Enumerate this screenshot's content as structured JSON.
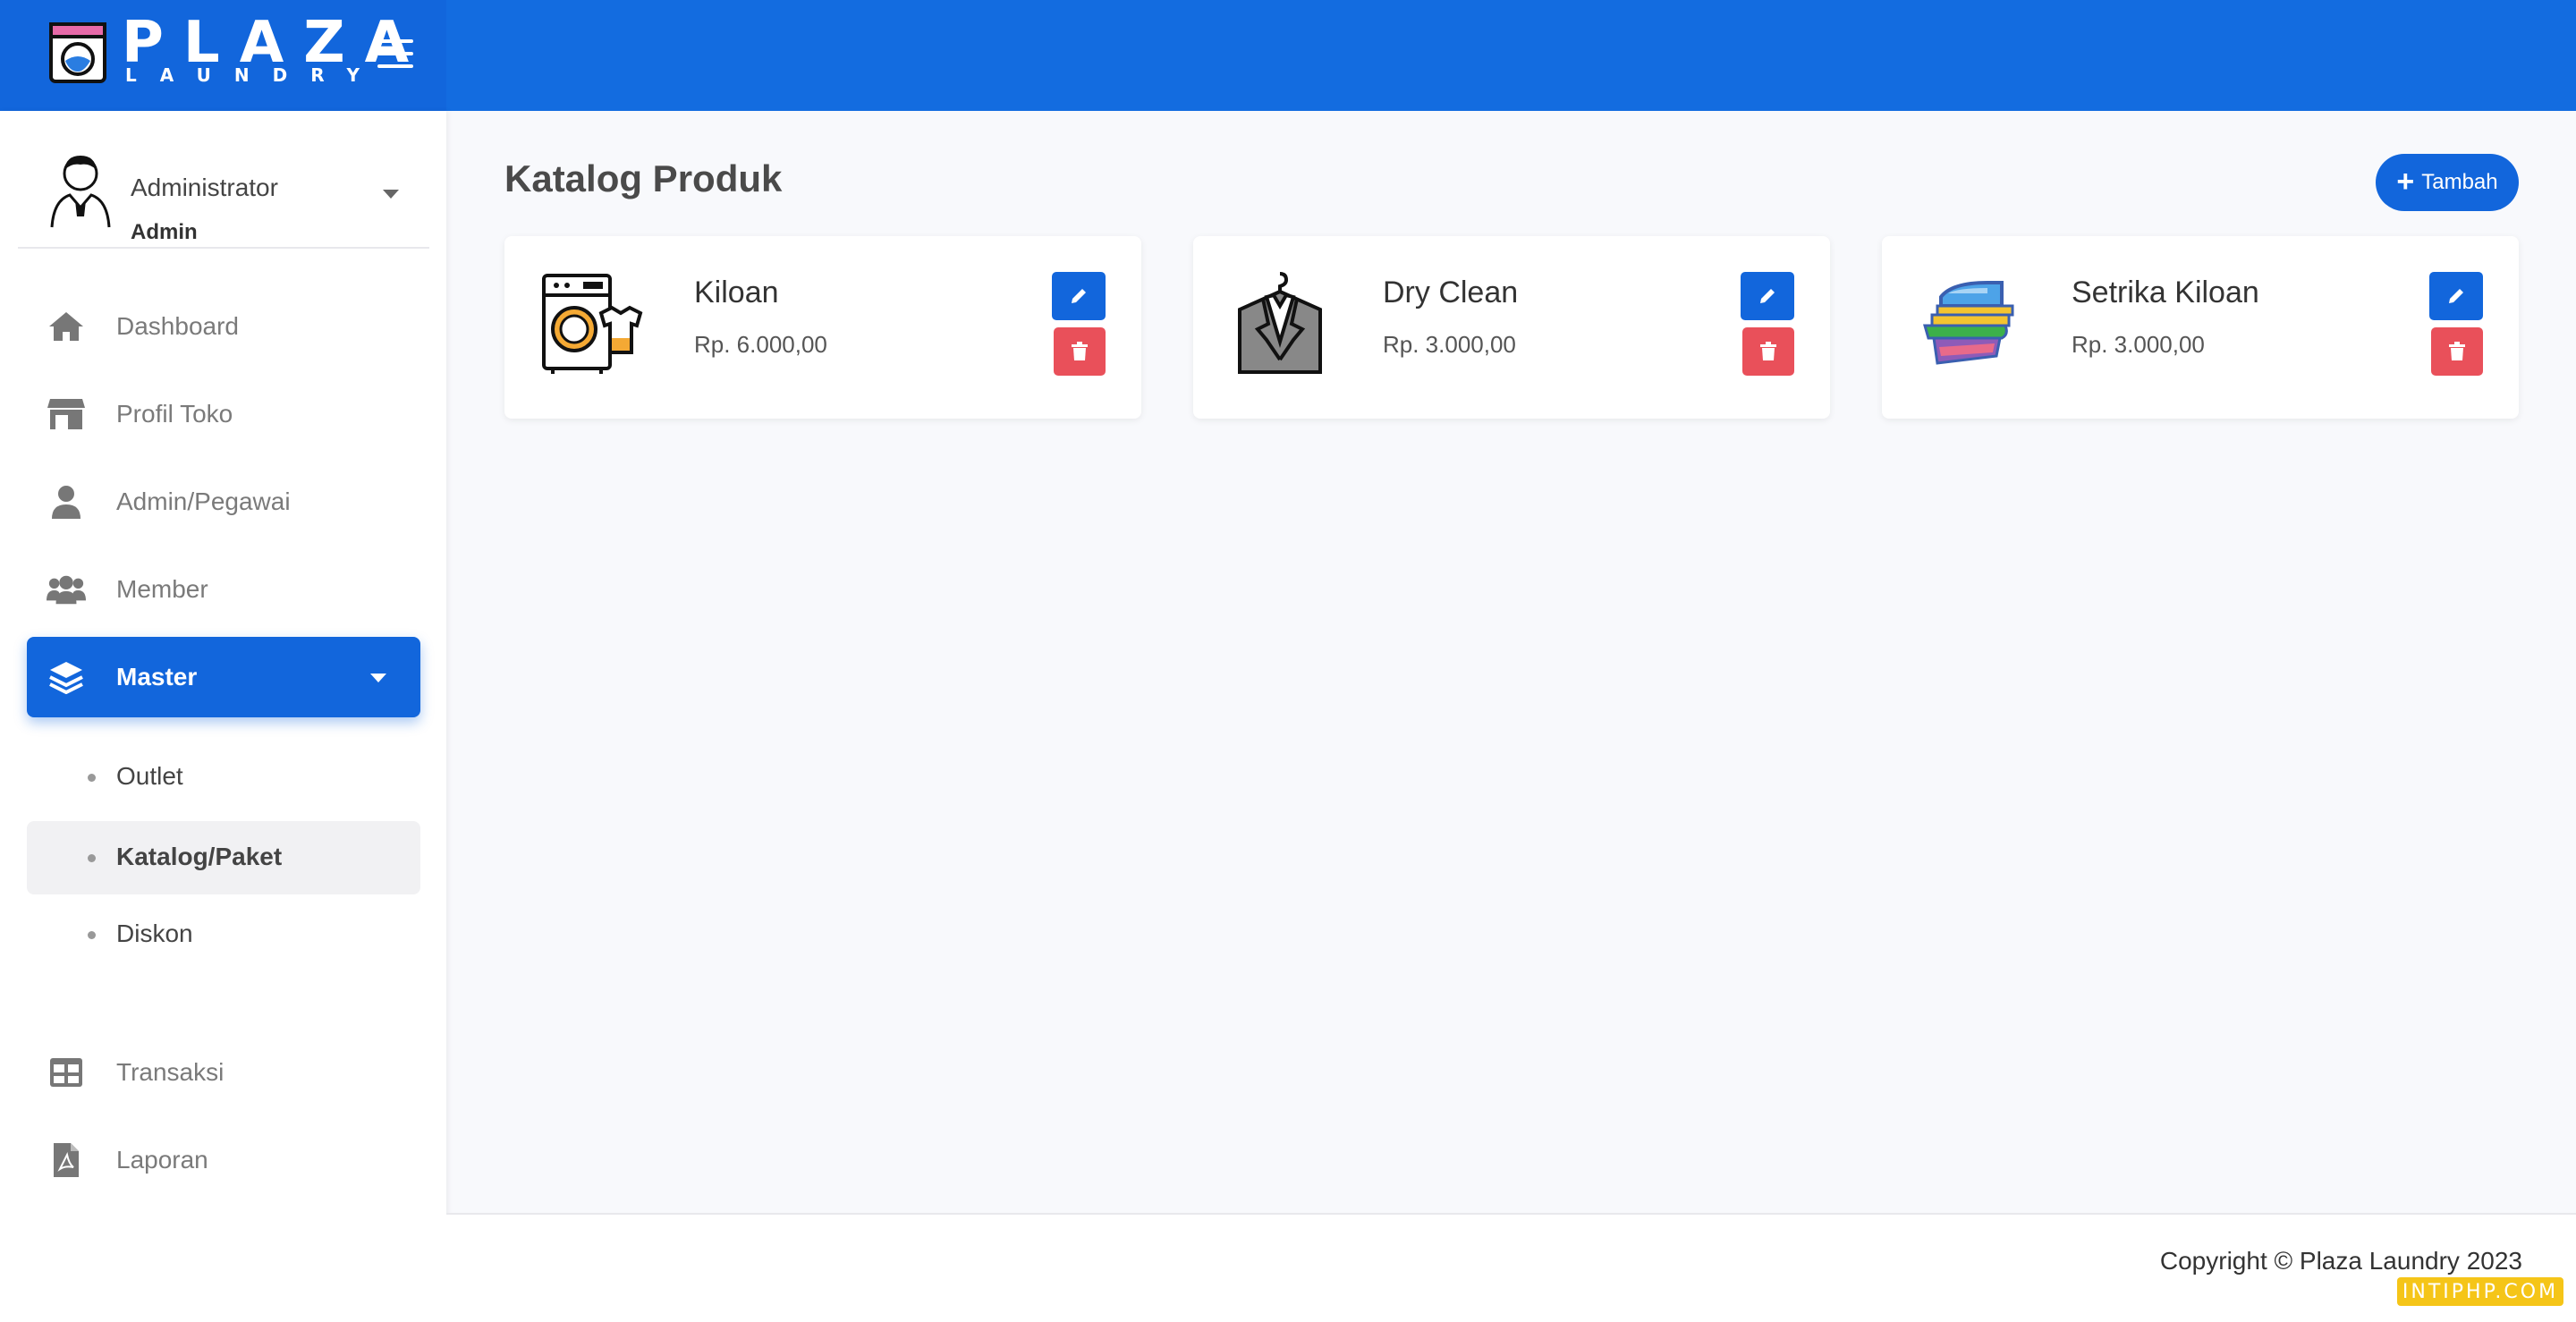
{
  "brand": {
    "name": "PLAZA",
    "sub": "LAUNDRY"
  },
  "user": {
    "name": "Administrator",
    "role": "Admin"
  },
  "nav": {
    "dashboard": "Dashboard",
    "profil_toko": "Profil Toko",
    "admin_pegawai": "Admin/Pegawai",
    "member": "Member",
    "master": "Master",
    "master_sub": [
      "Outlet",
      "Katalog/Paket",
      "Diskon"
    ],
    "transaksi": "Transaksi",
    "laporan": "Laporan"
  },
  "main": {
    "title": "Katalog Produk",
    "add_label": "Tambah",
    "products": [
      {
        "name": "Kiloan",
        "price": "Rp. 6.000,00",
        "icon": "washing-machine-icon"
      },
      {
        "name": "Dry Clean",
        "price": "Rp. 3.000,00",
        "icon": "suit-hanger-icon"
      },
      {
        "name": "Setrika Kiloan",
        "price": "Rp. 3.000,00",
        "icon": "iron-clothes-icon"
      }
    ]
  },
  "footer": {
    "copyright": "Copyright © Plaza Laundry 2023"
  },
  "watermark": "INTIPHP.COM",
  "colors": {
    "primary": "#1266dc",
    "danger": "#e9505a",
    "background": "#f8f9fc"
  }
}
